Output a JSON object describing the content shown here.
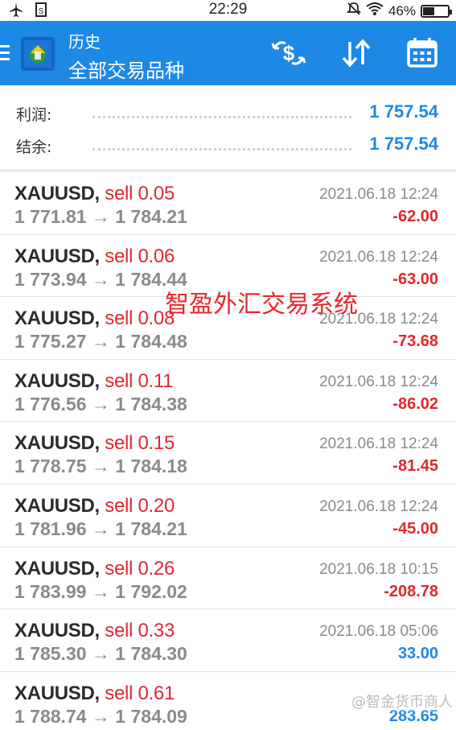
{
  "status_bar": {
    "time": "22:29",
    "battery": "46%",
    "battery_level": 0.46,
    "icons": [
      "airplane-icon",
      "sim-icon",
      "mute-icon",
      "wifi-icon",
      "battery-icon"
    ]
  },
  "header": {
    "title": "历史",
    "subtitle": "全部交易品种",
    "color": "#1e88e5",
    "actions": [
      "currency-exchange-icon",
      "sort-icon",
      "calendar-icon"
    ]
  },
  "summary": {
    "profit_label": "利润:",
    "profit_value": "1 757.54",
    "balance_label": "结余:",
    "balance_value": "1 757.54"
  },
  "trades": [
    {
      "symbol": "XAUUSD,",
      "side": "sell 0.05",
      "prices": "1 771.81 → 1 784.21",
      "date": "2021.06.18 12:24",
      "profit": "-62.00",
      "sign": "neg"
    },
    {
      "symbol": "XAUUSD,",
      "side": "sell 0.06",
      "prices": "1 773.94 → 1 784.44",
      "date": "2021.06.18 12:24",
      "profit": "-63.00",
      "sign": "neg"
    },
    {
      "symbol": "XAUUSD,",
      "side": "sell 0.08",
      "prices": "1 775.27 → 1 784.48",
      "date": "2021.06.18 12:24",
      "profit": "-73.68",
      "sign": "neg"
    },
    {
      "symbol": "XAUUSD,",
      "side": "sell 0.11",
      "prices": "1 776.56 → 1 784.38",
      "date": "2021.06.18 12:24",
      "profit": "-86.02",
      "sign": "neg"
    },
    {
      "symbol": "XAUUSD,",
      "side": "sell 0.15",
      "prices": "1 778.75 → 1 784.18",
      "date": "2021.06.18 12:24",
      "profit": "-81.45",
      "sign": "neg"
    },
    {
      "symbol": "XAUUSD,",
      "side": "sell 0.20",
      "prices": "1 781.96 → 1 784.21",
      "date": "2021.06.18 12:24",
      "profit": "-45.00",
      "sign": "neg"
    },
    {
      "symbol": "XAUUSD,",
      "side": "sell 0.26",
      "prices": "1 783.99 → 1 792.02",
      "date": "2021.06.18 10:15",
      "profit": "-208.78",
      "sign": "neg"
    },
    {
      "symbol": "XAUUSD,",
      "side": "sell 0.33",
      "prices": "1 785.30 → 1 784.30",
      "date": "2021.06.18 05:06",
      "profit": "33.00",
      "sign": "pos"
    },
    {
      "symbol": "XAUUSD,",
      "side": "sell 0.61",
      "prices": "1 788.74 → 1 784.09",
      "date": "",
      "profit": "283.65",
      "sign": "pos"
    }
  ],
  "watermarks": {
    "center": "智盈外汇交易系统",
    "corner": "@智金货币商人"
  }
}
